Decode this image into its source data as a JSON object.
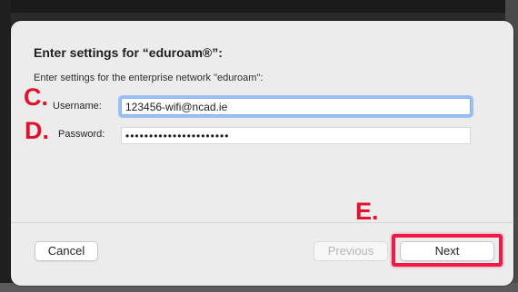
{
  "dialog": {
    "title": "Enter settings for “eduroam®”:",
    "subtitle": "Enter settings for the enterprise network \"eduroam\":"
  },
  "annotations": {
    "step_c": "C.",
    "step_d": "D.",
    "step_e": "E."
  },
  "form": {
    "username_label": "Username:",
    "username_value": "123456-wifi@ncad.ie",
    "password_label": "Password:",
    "password_value": "••••••••••••••••••••••"
  },
  "buttons": {
    "cancel": "Cancel",
    "previous": "Previous",
    "next": "Next"
  },
  "colors": {
    "annotation_red": "#e0122d",
    "highlight_border": "#f01a4a",
    "focus_ring": "#9cc0f3"
  }
}
